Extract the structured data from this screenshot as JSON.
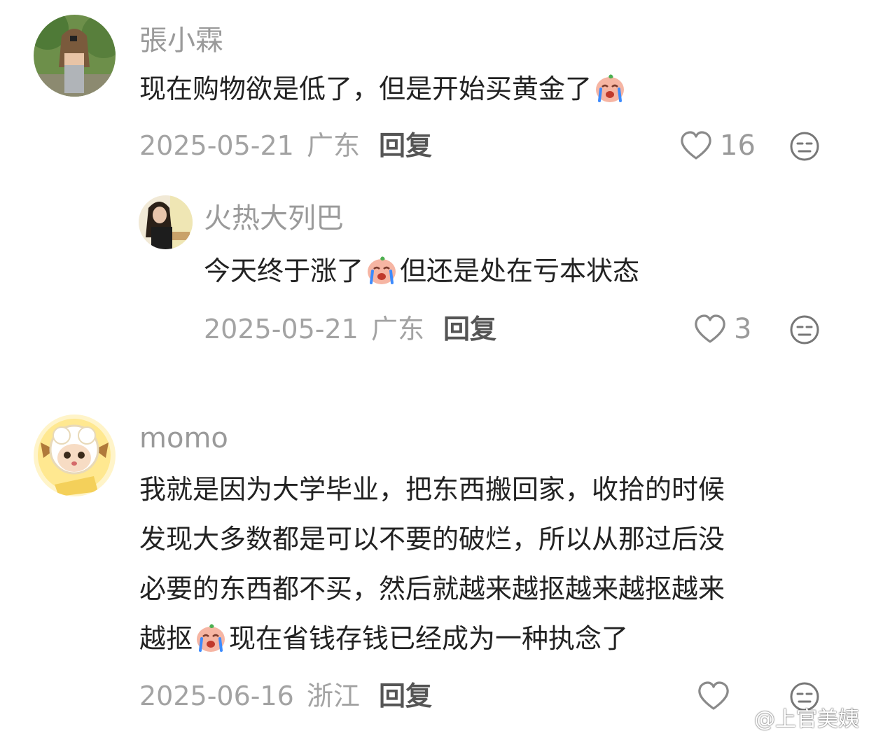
{
  "comments": [
    {
      "user": "張小霖",
      "text_lines": [
        "现在购物欲是低了，但是开始买黄金了"
      ],
      "date": "2025-05-21",
      "region": "广东",
      "reply_label": "回复",
      "likes": "16",
      "replies": [
        {
          "user": "火热大列巴",
          "text_before": "今天终于涨了",
          "text_after": "但还是处在亏本状态",
          "date": "2025-05-21",
          "region": "广东",
          "reply_label": "回复",
          "likes": "3"
        }
      ]
    },
    {
      "user": "momo",
      "text_lines": [
        "我就是因为大学毕业，把东西搬回家，收拾的时候",
        "发现大多数都是可以不要的破烂，所以从那过后没",
        "必要的东西都不买，然后就越来越抠越来越抠越来"
      ],
      "last_line_before": "越抠",
      "last_line_after": "现在省钱存钱已经成为一种执念了",
      "date": "2025-06-16",
      "region": "浙江",
      "reply_label": "回复",
      "likes": ""
    }
  ],
  "watermark": "@上官美姨",
  "icons": {
    "like": "heart-outline-icon",
    "dislike": "unamused-face-icon",
    "emoji": "crying-peach-emoji",
    "watermark": "weibo-logo-icon"
  },
  "colors": {
    "meta": "#a3a3a3",
    "text": "#222222",
    "username": "#9a9a9a"
  }
}
